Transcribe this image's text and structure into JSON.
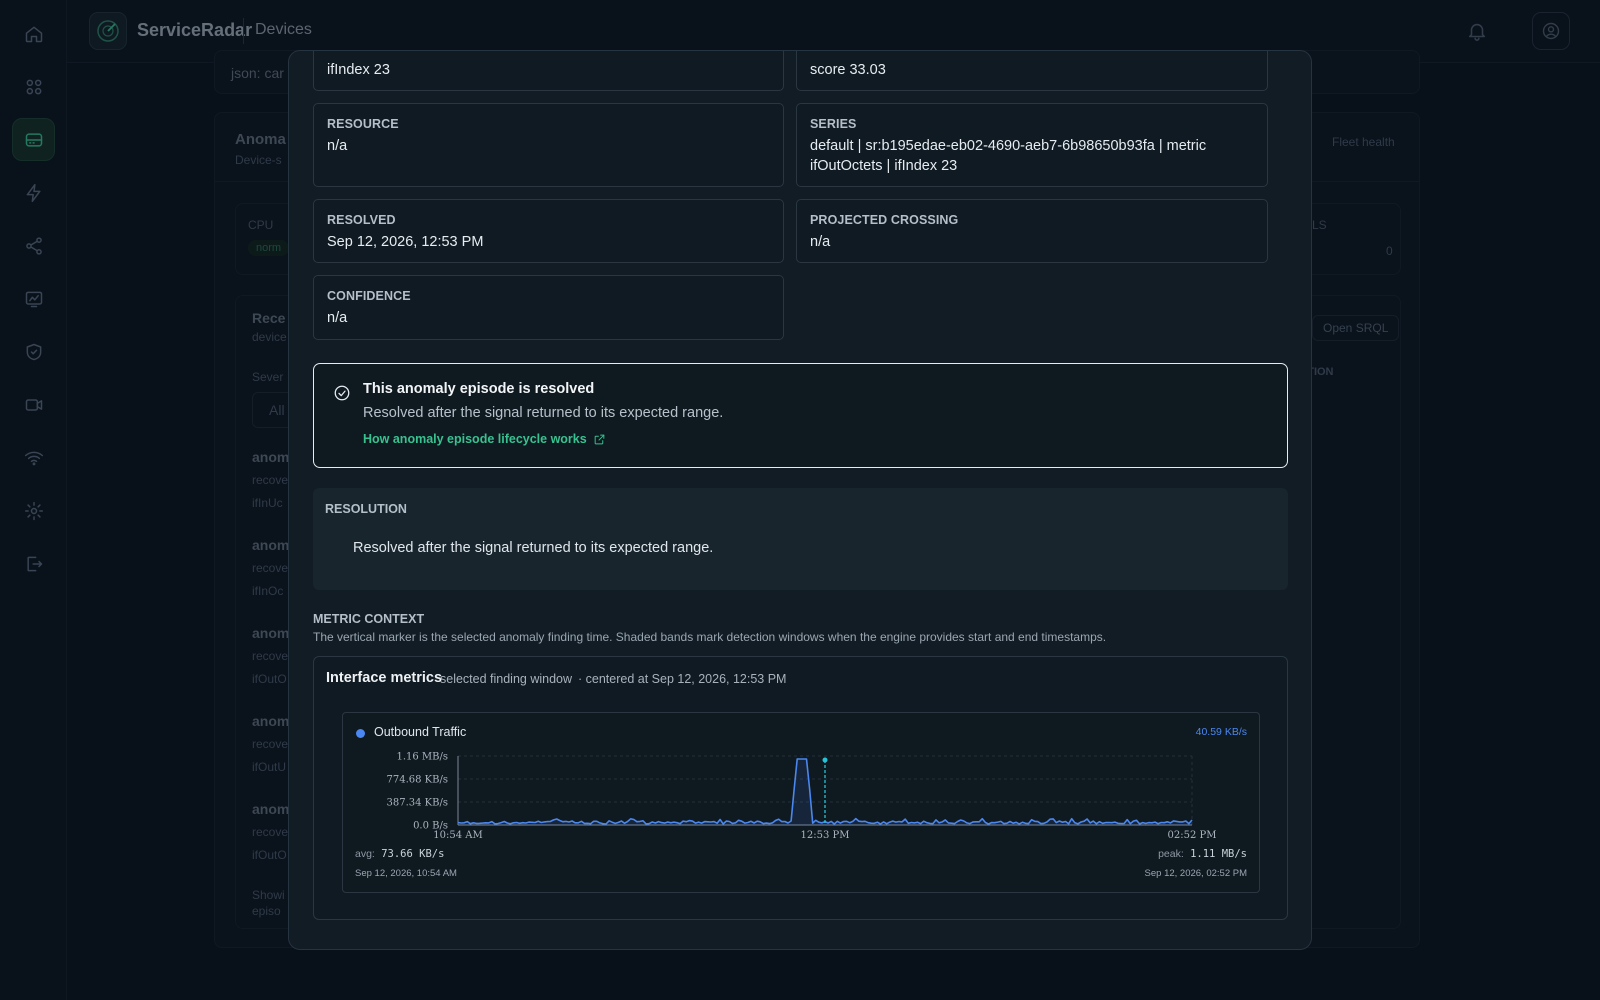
{
  "app": {
    "name": "ServiceRadar",
    "section": "Devices"
  },
  "background": {
    "json_prefix": "json: car",
    "anomalies_title": "Anoma",
    "anomalies_sub": "Device-s",
    "settings_tab": "ngs",
    "fleet_tab": "Fleet health",
    "cpu_label": "CPU",
    "cpu_badge": "norm",
    "signals_label": "GNALS",
    "signals_value": "0",
    "recent_title": "Rece",
    "recent_sub": "device",
    "severity_label": "Sever",
    "filter_value": "All",
    "open_srql": "Open SRQL",
    "exhaustion_col": "AUSTION",
    "rows": [
      {
        "title": "anom",
        "sub": "recove",
        "meta": "ifInUc"
      },
      {
        "title": "anom",
        "sub": "recove",
        "meta": "ifInOc"
      },
      {
        "title": "anom",
        "sub": "recove",
        "meta": "ifOutO"
      },
      {
        "title": "anom",
        "sub": "recove",
        "meta": "ifOutU"
      },
      {
        "title": "anom",
        "sub": "recove",
        "meta": "ifOutO"
      }
    ],
    "footer_1": "Showi",
    "footer_2": "episo"
  },
  "modal": {
    "fields": {
      "interface_value": "ifIndex 23",
      "score_value": "score 33.03",
      "resource_label": "RESOURCE",
      "resource_value": "n/a",
      "series_label": "SERIES",
      "series_line1": "default | sr:b195edae-eb02-4690-aeb7-6b98650b93fa | metric",
      "series_line2": "ifOutOctets | ifIndex 23",
      "resolved_label": "RESOLVED",
      "resolved_value": "Sep 12, 2026, 12:53 PM",
      "crossing_label": "PROJECTED CROSSING",
      "crossing_value": "n/a",
      "confidence_label": "CONFIDENCE",
      "confidence_value": "n/a"
    },
    "callout": {
      "title": "This anomaly episode is resolved",
      "body": "Resolved after the signal returned to its expected range.",
      "link": "How anomaly episode lifecycle works"
    },
    "resolution": {
      "label": "RESOLUTION",
      "text": "Resolved after the signal returned to its expected range."
    },
    "metric_context": {
      "label": "METRIC CONTEXT",
      "description": "The vertical marker is the selected anomaly finding time. Shaded bands mark detection windows when the engine provides start and end timestamps."
    },
    "metrics_card": {
      "title": "Interface metrics",
      "window": "selected finding window",
      "centered": "· centered at Sep 12, 2026, 12:53 PM"
    }
  },
  "chart_data": {
    "type": "line",
    "series": [
      {
        "name": "Outbound Traffic",
        "color": "#4a87f0"
      }
    ],
    "current_value": "40.59 KB/s",
    "y_ticks": [
      "1.16 MB/s",
      "774.68 KB/s",
      "387.34 KB/s",
      "0.0 B/s"
    ],
    "x_ticks": [
      "10:54 AM",
      "12:53 PM",
      "02:52 PM"
    ],
    "ylim": [
      0,
      1160
    ],
    "y_unit": "KB/s",
    "x_minutes_range": [
      0,
      238
    ],
    "marker_minute": 119,
    "baseline_kbps": 40,
    "spike": {
      "start_minute": 109,
      "end_minute": 114,
      "value_kbps": 1110
    },
    "avg_label": "avg:",
    "avg_value": "73.66 KB/s",
    "peak_label": "peak:",
    "peak_value": "1.11 MB/s",
    "start_date": "Sep 12, 2026, 10:54 AM",
    "end_date": "Sep 12, 2026, 02:52 PM"
  }
}
